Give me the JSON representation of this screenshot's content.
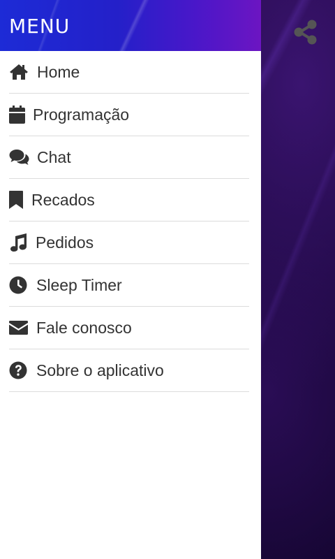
{
  "drawer": {
    "title": "MENU",
    "items": [
      {
        "label": "Home",
        "icon": "home-icon"
      },
      {
        "label": "Programação",
        "icon": "calendar-icon"
      },
      {
        "label": "Chat",
        "icon": "chat-icon"
      },
      {
        "label": "Recados",
        "icon": "bookmark-icon"
      },
      {
        "label": "Pedidos",
        "icon": "music-note-icon"
      },
      {
        "label": "Sleep Timer",
        "icon": "clock-icon"
      },
      {
        "label": "Fale conosco",
        "icon": "envelope-icon"
      },
      {
        "label": "Sobre o aplicativo",
        "icon": "question-circle-icon"
      }
    ]
  },
  "app_bar": {
    "share_icon": "share-icon"
  },
  "colors": {
    "header_start": "#1d2bd6",
    "header_end": "#6c15c2",
    "text": "#333333",
    "divider": "#dcdcdc",
    "background_dark": "#0c0420"
  }
}
